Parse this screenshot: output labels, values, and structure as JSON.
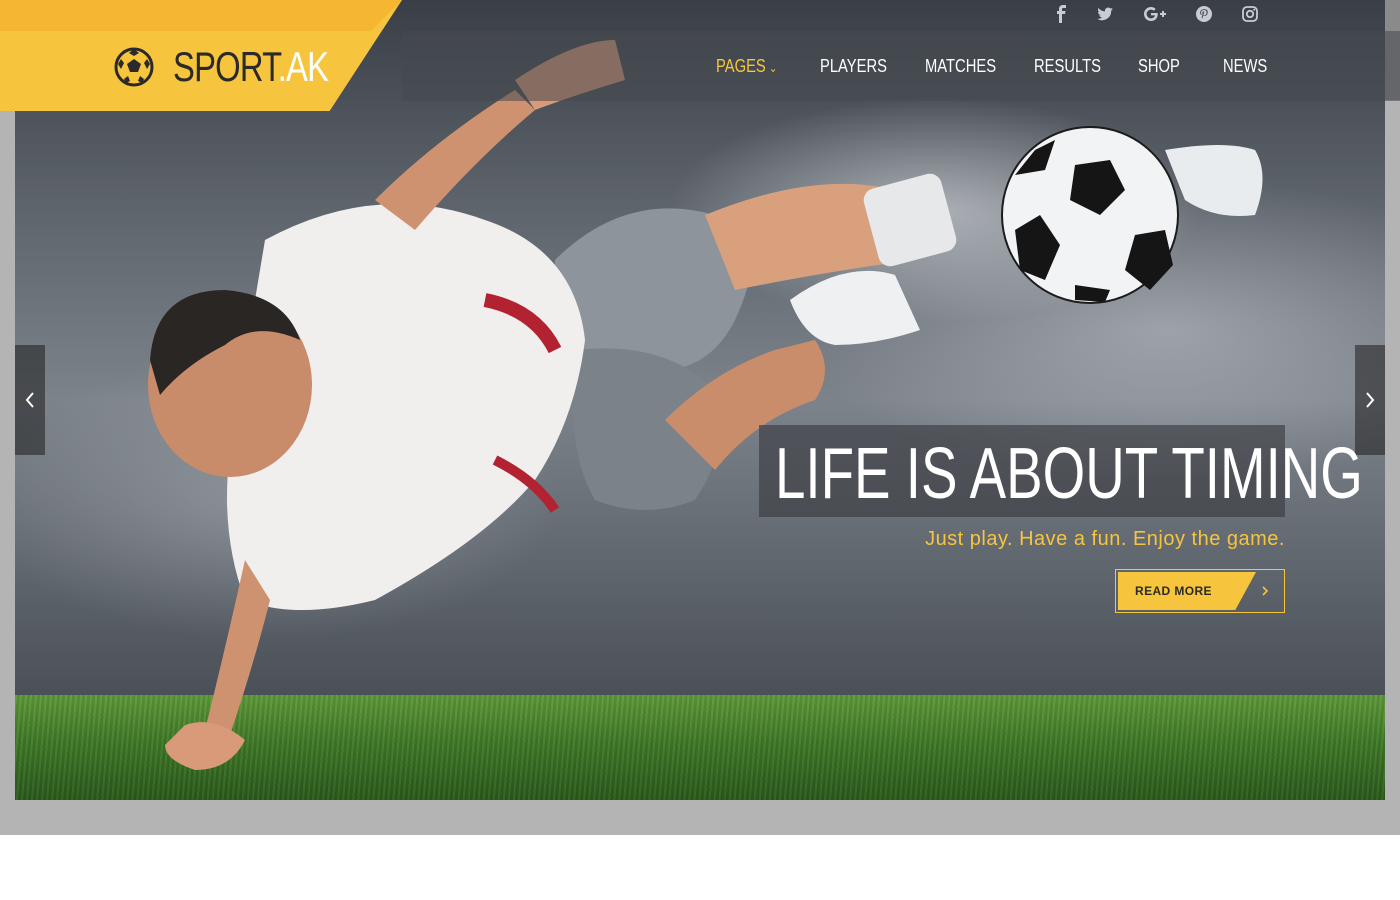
{
  "brand": {
    "name_main": "SPORT",
    "name_accent": ".AK"
  },
  "nav": {
    "items": [
      {
        "label": "PAGES"
      },
      {
        "label": "PLAYERS"
      },
      {
        "label": "MATCHES"
      },
      {
        "label": "RESULTS"
      },
      {
        "label": "SHOP"
      },
      {
        "label": "NEWS"
      }
    ]
  },
  "social": [
    "facebook-icon",
    "twitter-icon",
    "google-plus-icon",
    "pinterest-icon",
    "instagram-icon"
  ],
  "slide": {
    "headline": "LIFE IS ABOUT TIMING",
    "subline": "Just play. Have a fun. Enjoy the game.",
    "button_label": "READ MORE"
  },
  "colors": {
    "accent": "#f7c53d",
    "accent_dark": "#f5b731",
    "text_dark": "#2a2a2a"
  }
}
